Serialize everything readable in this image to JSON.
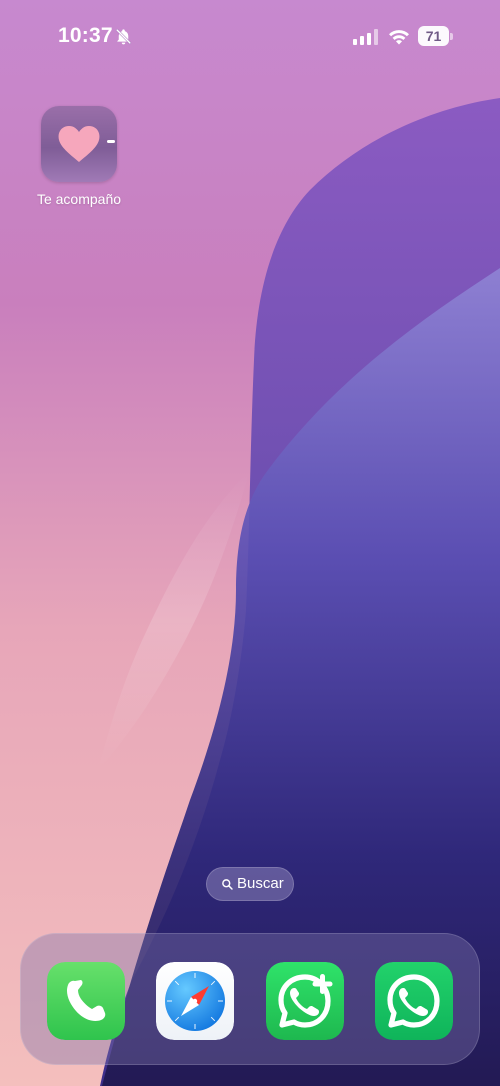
{
  "status_bar": {
    "time": "10:37",
    "battery_level": "71",
    "silent_mode_icon": "bell-slash-icon",
    "signal_icon": "cellular-signal-icon",
    "wifi_icon": "wifi-icon"
  },
  "home_screen": {
    "apps": [
      {
        "label": "Te acompaño",
        "icon": "heart-icon"
      }
    ],
    "search_label": "Buscar"
  },
  "dock": {
    "apps": [
      {
        "name": "Phone",
        "icon": "phone-icon"
      },
      {
        "name": "Safari",
        "icon": "safari-compass-icon"
      },
      {
        "name": "WhatsApp Business",
        "icon": "whatsapp-plus-icon"
      },
      {
        "name": "WhatsApp",
        "icon": "whatsapp-icon"
      }
    ]
  },
  "colors": {
    "wallpaper_pink": "#d47fb8",
    "wallpaper_purple": "#6a4fb3",
    "wallpaper_navy": "#2b1f6a",
    "phone_green": "#4cd964",
    "whatsapp_green": "#25d366"
  }
}
